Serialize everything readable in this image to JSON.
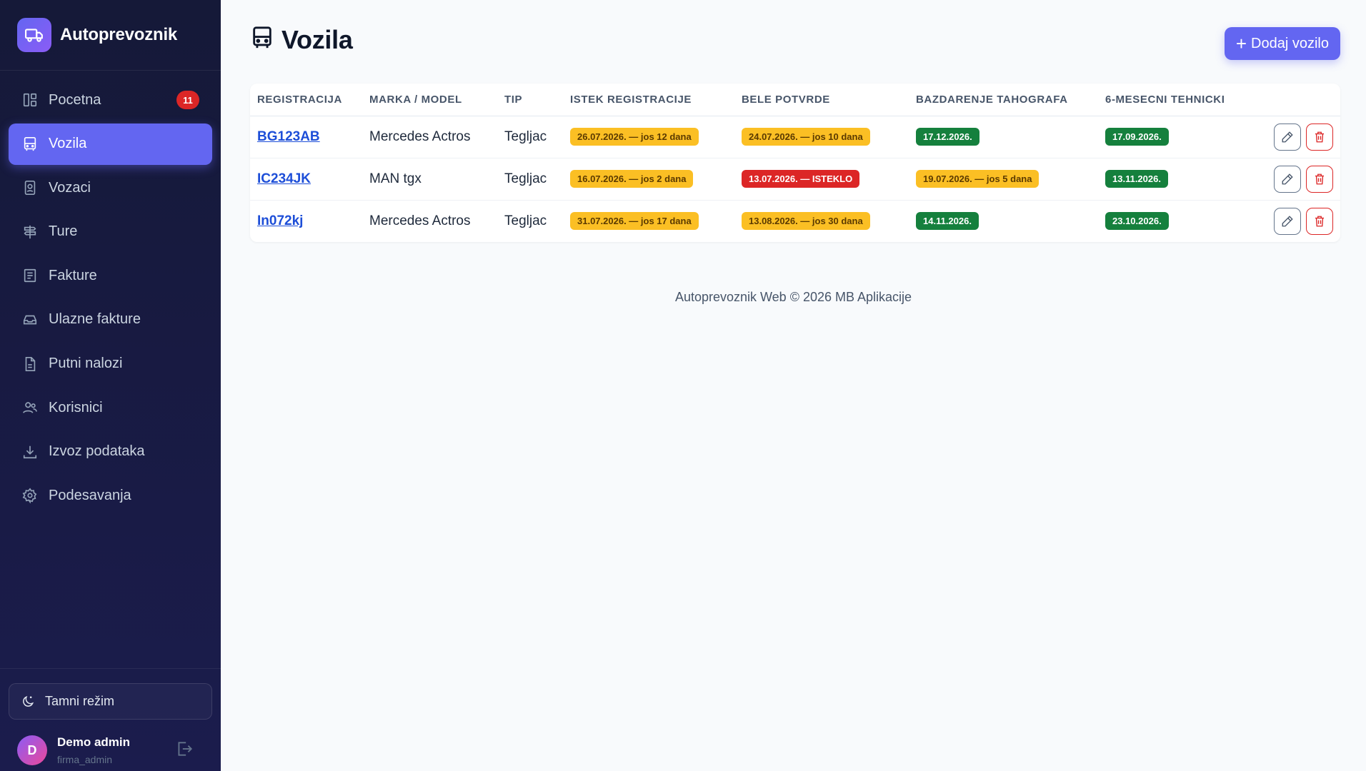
{
  "app": {
    "name": "Autoprevoznik"
  },
  "sidebar": {
    "items": [
      {
        "label": "Pocetna",
        "icon": "dashboard-icon",
        "badge": "11",
        "active": false
      },
      {
        "label": "Vozila",
        "icon": "bus-icon",
        "active": true
      },
      {
        "label": "Vozaci",
        "icon": "id-badge-icon",
        "active": false
      },
      {
        "label": "Ture",
        "icon": "signpost-icon",
        "active": false
      },
      {
        "label": "Fakture",
        "icon": "invoice-icon",
        "active": false
      },
      {
        "label": "Ulazne fakture",
        "icon": "inbox-icon",
        "active": false
      },
      {
        "label": "Putni nalozi",
        "icon": "document-icon",
        "active": false
      },
      {
        "label": "Korisnici",
        "icon": "users-icon",
        "active": false
      },
      {
        "label": "Izvoz podataka",
        "icon": "download-icon",
        "active": false
      },
      {
        "label": "Podesavanja",
        "icon": "gear-icon",
        "active": false
      }
    ],
    "dark_mode_label": "Tamni režim",
    "user": {
      "initial": "D",
      "name": "Demo admin",
      "role": "firma_admin"
    }
  },
  "page": {
    "title": "Vozila",
    "add_button": "Dodaj vozilo"
  },
  "table": {
    "columns": [
      "Registracija",
      "Marka / Model",
      "Tip",
      "Istek registracije",
      "Bele potvrde",
      "Bazdarenje tahografa",
      "6-mesecni tehnicki"
    ],
    "rows": [
      {
        "registracija": "BG123AB",
        "model": "Mercedes Actros",
        "tip": "Tegljac",
        "istek": {
          "text": "26.07.2026. — jos 12 dana",
          "status": "warn"
        },
        "bele": {
          "text": "24.07.2026. — jos 10 dana",
          "status": "warn"
        },
        "tahograf": {
          "text": "17.12.2026.",
          "status": "ok"
        },
        "tehnicki": {
          "text": "17.09.2026.",
          "status": "ok"
        }
      },
      {
        "registracija": "IC234JK",
        "model": "MAN tgx",
        "tip": "Tegljac",
        "istek": {
          "text": "16.07.2026. — jos 2 dana",
          "status": "warn"
        },
        "bele": {
          "text": "13.07.2026. — ISTEKLO",
          "status": "danger"
        },
        "tahograf": {
          "text": "19.07.2026. — jos 5 dana",
          "status": "warn"
        },
        "tehnicki": {
          "text": "13.11.2026.",
          "status": "ok"
        }
      },
      {
        "registracija": "In072kj",
        "model": "Mercedes Actros",
        "tip": "Tegljac",
        "istek": {
          "text": "31.07.2026. — jos 17 dana",
          "status": "warn"
        },
        "bele": {
          "text": "13.08.2026. — jos 30 dana",
          "status": "warn"
        },
        "tahograf": {
          "text": "14.11.2026.",
          "status": "ok"
        },
        "tehnicki": {
          "text": "23.10.2026.",
          "status": "ok"
        }
      }
    ]
  },
  "footer": {
    "text": "Autoprevoznik Web © 2026 MB Aplikacije"
  },
  "colors": {
    "accent": "#6366f1",
    "warn": "#fbbf24",
    "danger": "#dc2626",
    "ok": "#15803d",
    "sidebar_bg": "#151938"
  }
}
